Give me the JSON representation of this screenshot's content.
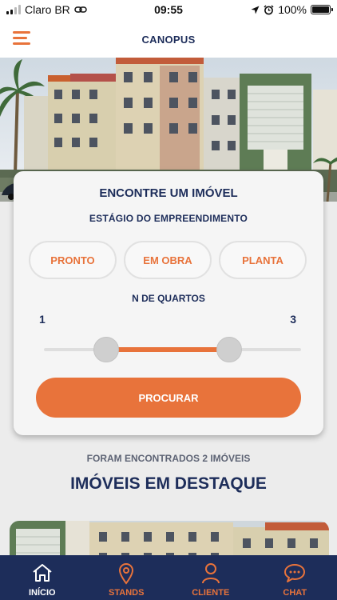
{
  "status_bar": {
    "carrier": "Claro BR",
    "time": "09:55",
    "battery": "100%"
  },
  "header": {
    "title": "CANOPUS",
    "menu_icon": "hamburger-menu-icon"
  },
  "search": {
    "title": "ENCONTRE UM IMÓVEL",
    "stage_label": "ESTÁGIO DO EMPREENDIMENTO",
    "stages": [
      "PRONTO",
      "EM OBRA",
      "PLANTA"
    ],
    "rooms_label": "N DE QUARTOS",
    "rooms_min": "1",
    "rooms_max": "3",
    "search_button": "PROCURAR"
  },
  "results": {
    "found_text": "FORAM ENCONTRADOS 2 IMÓVEIS",
    "section_title": "IMÓVEIS EM DESTAQUE"
  },
  "bottom_nav": [
    {
      "label": "INÍCIO",
      "icon": "home-icon"
    },
    {
      "label": "STANDS",
      "icon": "map-pin-icon"
    },
    {
      "label": "CLIENTE",
      "icon": "user-icon"
    },
    {
      "label": "CHAT",
      "icon": "chat-bubble-icon"
    }
  ],
  "colors": {
    "accent": "#e8733b",
    "navy": "#1d2d5a",
    "background": "#ececec",
    "card": "#f5f5f5"
  }
}
